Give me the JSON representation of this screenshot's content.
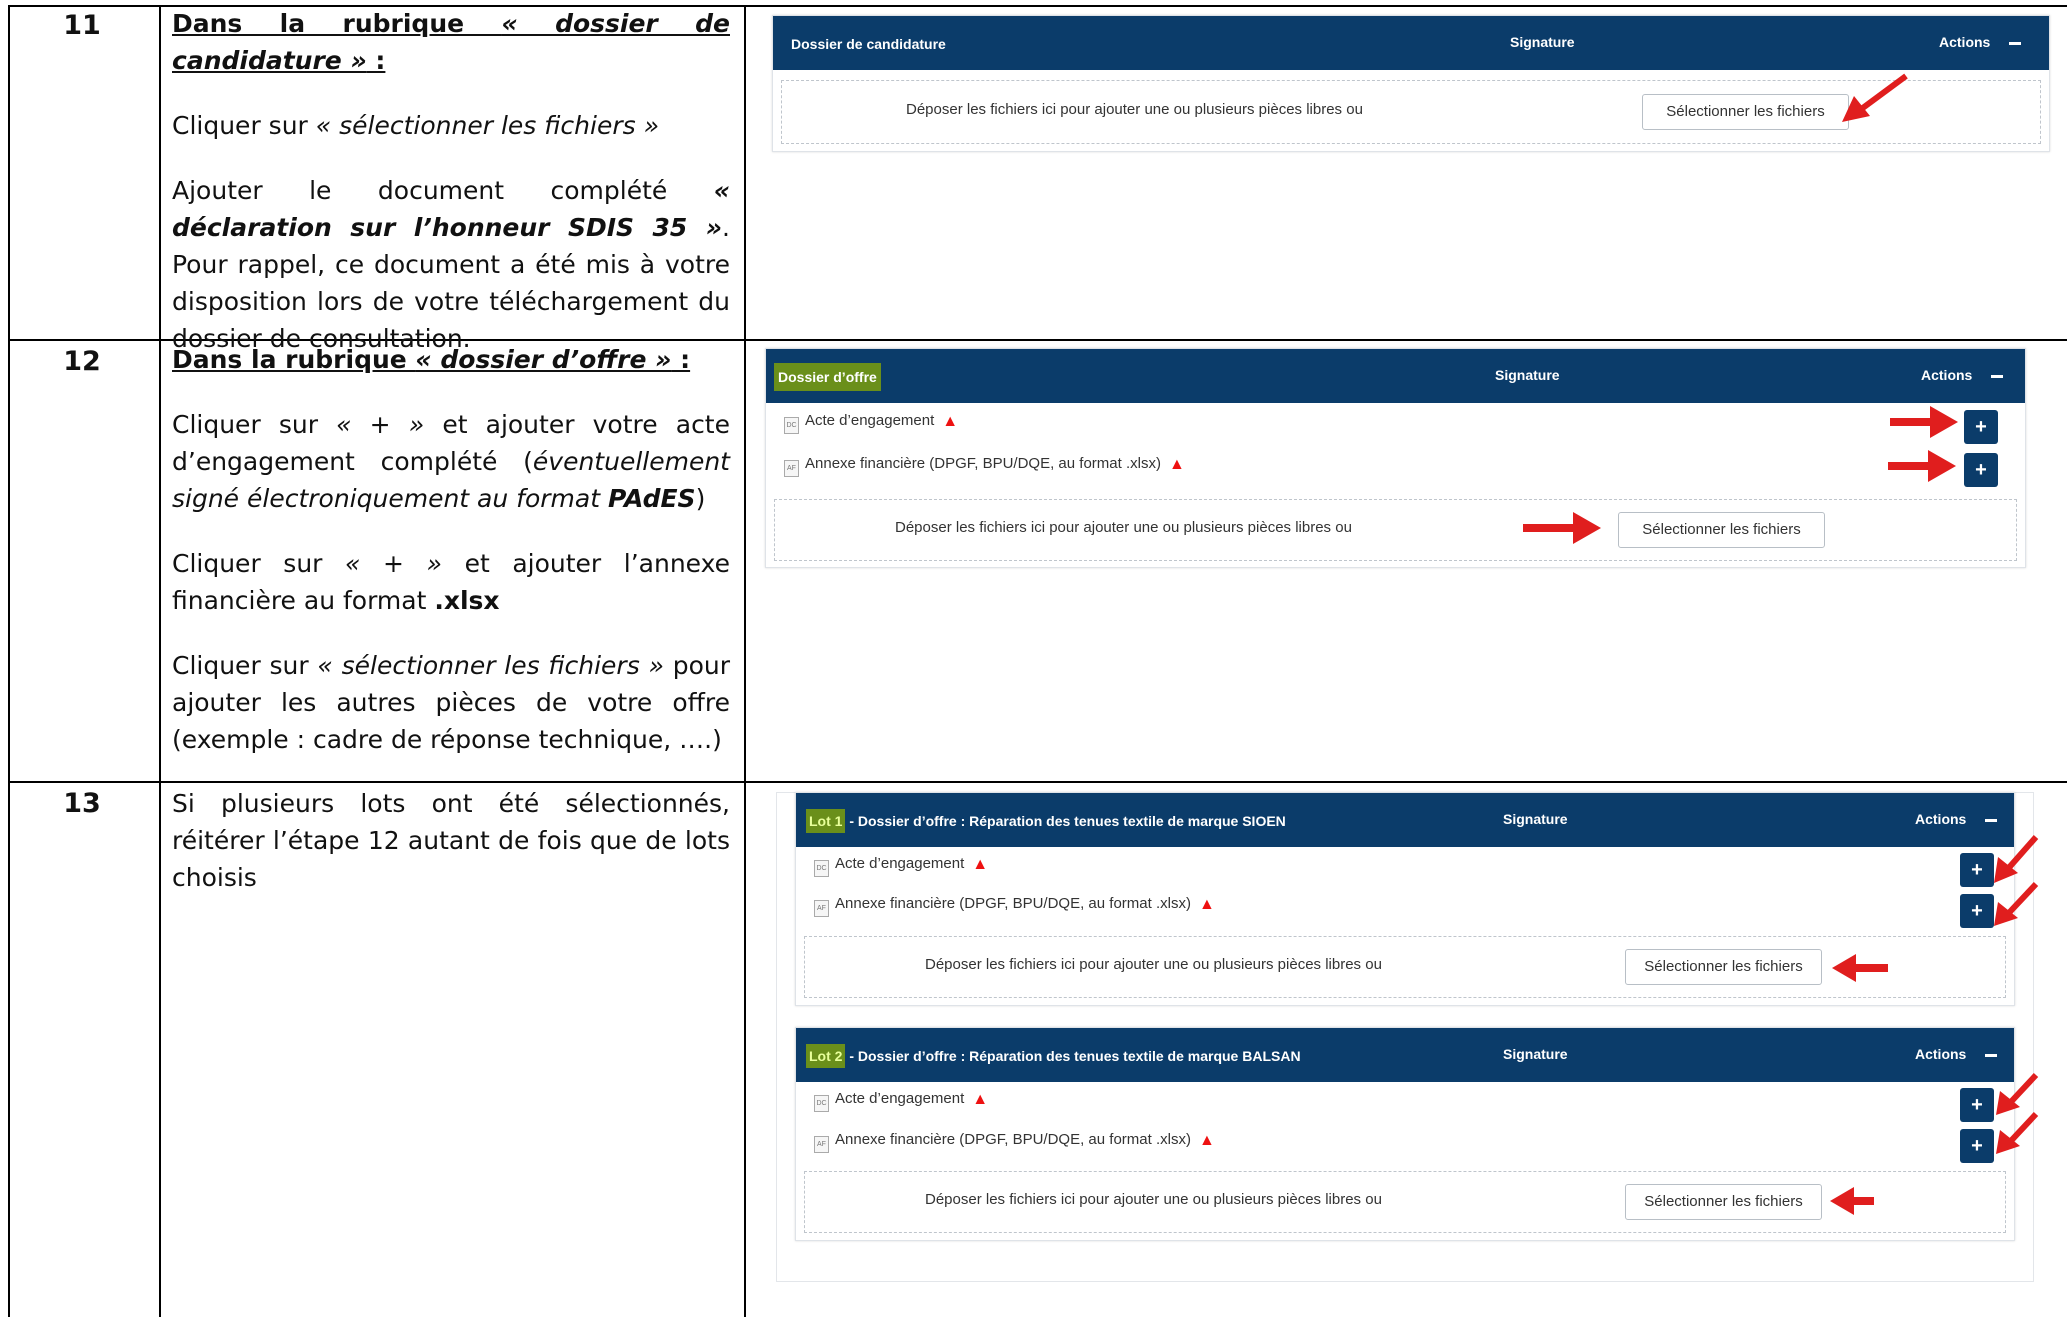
{
  "steps": [
    {
      "number": "11",
      "header_prefix": "Dans la rubrique ",
      "header_em": "« dossier de candidature »",
      "header_suffix": " :",
      "p1_a": "Cliquer sur ",
      "p1_em": "« sélectionner les fichiers »",
      "p2_a": "Ajouter le document complété ",
      "p2_b": "« déclaration sur l’honneur SDIS 35 »",
      "p2_c": ". Pour rappel, ce document a été mis à votre disposition lors de votre téléchargement du dossier de consultation."
    },
    {
      "number": "12",
      "header_prefix": "Dans la rubrique ",
      "header_em": "« dossier d’offre »",
      "header_suffix": " :",
      "p1_a": "Cliquer sur ",
      "p1_em": "« + »",
      "p1_b": " et ajouter votre acte d’engagement complété (",
      "p1_i": "éventuellement signé électroniquement au format ",
      "p1_bold": "PAdES",
      "p1_c": ")",
      "p2_a": "Cliquer sur ",
      "p2_em": "« + »",
      "p2_b": " et ajouter l’annexe financière au format ",
      "p2_bold": ".xlsx",
      "p3_a": "Cliquer sur ",
      "p3_em": "« sélectionner les fichiers »",
      "p3_b": " pour ajouter les autres pièces de votre offre (exemple : cadre de réponse technique,  ….)"
    },
    {
      "number": "13",
      "p1": "Si plusieurs lots ont été sélectionnés, réitérer l’étape 12 autant de fois que de lots choisis"
    }
  ],
  "ui": {
    "signature_label": "Signature",
    "actions_label": "Actions",
    "drop_text": "Déposer les fichiers ici pour ajouter une ou plusieurs pièces libres ou",
    "select_button": "Sélectionner les fichiers",
    "plus_label": "+",
    "doc_ae": "Acte d’engagement",
    "doc_af": "Annexe financière (DPGF, BPU/DQE, au format .xlsx)",
    "icon_ae": "DC",
    "icon_af": "AF",
    "candidature_title": "Dossier de candidature",
    "offre_title": "Dossier d’offre",
    "lot1_tag": "Lot 1",
    "lot1_title": " - Dossier d’offre : Réparation des tenues textile de marque SIOEN",
    "lot2_tag": "Lot 2",
    "lot2_title": " - Dossier d’offre : Réparation des tenues textile de marque BALSAN"
  },
  "colors": {
    "header_blue": "#0b3c6a",
    "highlight_green": "#86c900",
    "arrow_red": "#e01e1e",
    "warning_red": "#e11111"
  },
  "icons": [
    "document-icon",
    "warning-icon",
    "plus-icon",
    "minus-icon",
    "red-arrow"
  ]
}
